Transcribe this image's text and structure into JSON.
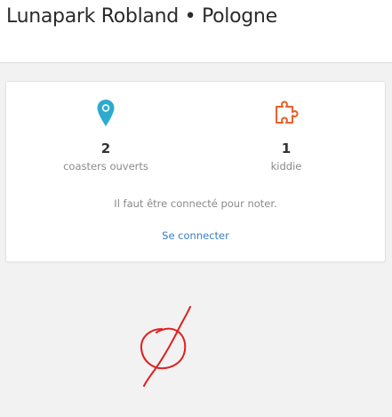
{
  "header": {
    "title": "Lunapark Robland • Pologne"
  },
  "stats": {
    "coasters": {
      "count": "2",
      "label": "coasters ouverts",
      "icon": "map-pin-icon",
      "color": "#2eaacf"
    },
    "kiddie": {
      "count": "1",
      "label": "kiddie",
      "icon": "puzzle-icon",
      "color": "#e8612c"
    }
  },
  "login": {
    "message": "Il faut être connecté pour noter.",
    "link_label": "Se connecter",
    "link_color": "#3a7fc1"
  },
  "annotation": {
    "icon": "red-scribble-annotation",
    "color": "#e02020"
  }
}
